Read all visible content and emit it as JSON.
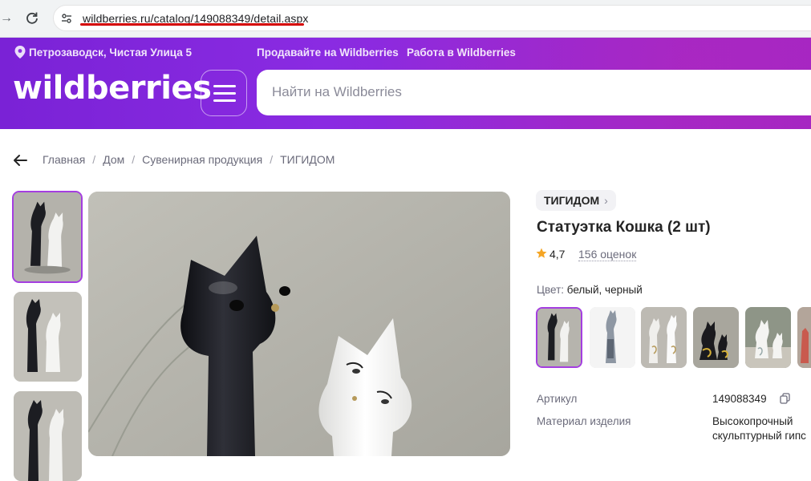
{
  "browser": {
    "url": "wildberries.ru/catalog/149088349/detail.aspx"
  },
  "header": {
    "location": "Петрозаводск, Чистая Улица 5",
    "links": [
      "Продавайте на Wildberries",
      "Работа в Wildberries"
    ],
    "logo": "wildberries",
    "search_placeholder": "Найти на Wildberries"
  },
  "breadcrumbs": [
    "Главная",
    "Дом",
    "Сувенирная продукция",
    "ТИГИДОМ"
  ],
  "product": {
    "brand": "ТИГИДОМ",
    "title": "Статуэтка Кошка (2 шт)",
    "rating": "4,7",
    "reviews": "156 оценок",
    "color_label": "Цвет:",
    "color_value": "белый, черный",
    "specs": [
      {
        "key": "Артикул",
        "value": "149088349"
      },
      {
        "key": "Материал изделия",
        "value": "Высокопрочный",
        "value2": "скульптурный гипс"
      }
    ]
  },
  "colors": {
    "accent": "#a43ee0",
    "header_purple": "#8a2be2"
  }
}
